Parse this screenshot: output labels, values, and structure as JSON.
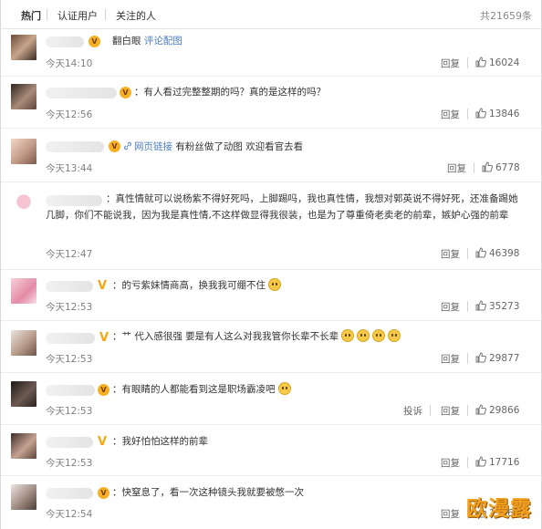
{
  "tabs": [
    {
      "label": "热门",
      "active": true
    },
    {
      "label": "认证用户",
      "active": false
    },
    {
      "label": "关注的人",
      "active": false
    }
  ],
  "total_count": "共21659条",
  "reply_label": "回复",
  "report_label": "投诉",
  "comments": [
    {
      "text_link": "翻白眼",
      "link": "评论配图",
      "time": "今天14:10",
      "likes": "16024"
    },
    {
      "text": "：有人看过完整整期的吗？真的是这样的吗？",
      "time": "今天12:56",
      "likes": "13846"
    },
    {
      "link": "网页链接",
      "text": "有粉丝做了动图 欢迎看官去看",
      "time": "今天13:44",
      "likes": "6778"
    },
    {
      "text": "：真性情就可以说杨紫不得好死吗，上脚踢吗，我也真性情，我想对郭英说不得好死，还准备踢她几脚，你们不能说我，因为我是真性情,不这样做显得我很装，也是为了尊重倚老卖老的前辈，嫉妒心强的前辈",
      "time": "今天12:47",
      "likes": "46398"
    },
    {
      "text": "：的亏紫妹情商高，换我我可绷不住",
      "time": "今天12:53",
      "likes": "35273"
    },
    {
      "text": "：艹 代入感很强 要是有人这么对我我管你长辈不长辈",
      "time": "今天12:53",
      "likes": "29877"
    },
    {
      "text": "：有眼睛的人都能看到这是职场霸凌吧",
      "time": "今天12:53",
      "likes": "29866"
    },
    {
      "text": "：我好怕怕这样的前辈",
      "time": "今天12:53",
      "likes": "17716"
    },
    {
      "text": "：快窒息了，看一次这种镜头我就要被憋一次",
      "time": "今天12:54",
      "likes": "15860"
    }
  ],
  "watermark": "欧漫露",
  "colors": {
    "link": "#4b7dbf",
    "time": "#808080",
    "badge": "#f6b026",
    "watermark": "#f2a01e"
  },
  "icons": [
    "thumbs-up-icon",
    "link-icon",
    "emoji-icon",
    "vip-badge-icon"
  ]
}
